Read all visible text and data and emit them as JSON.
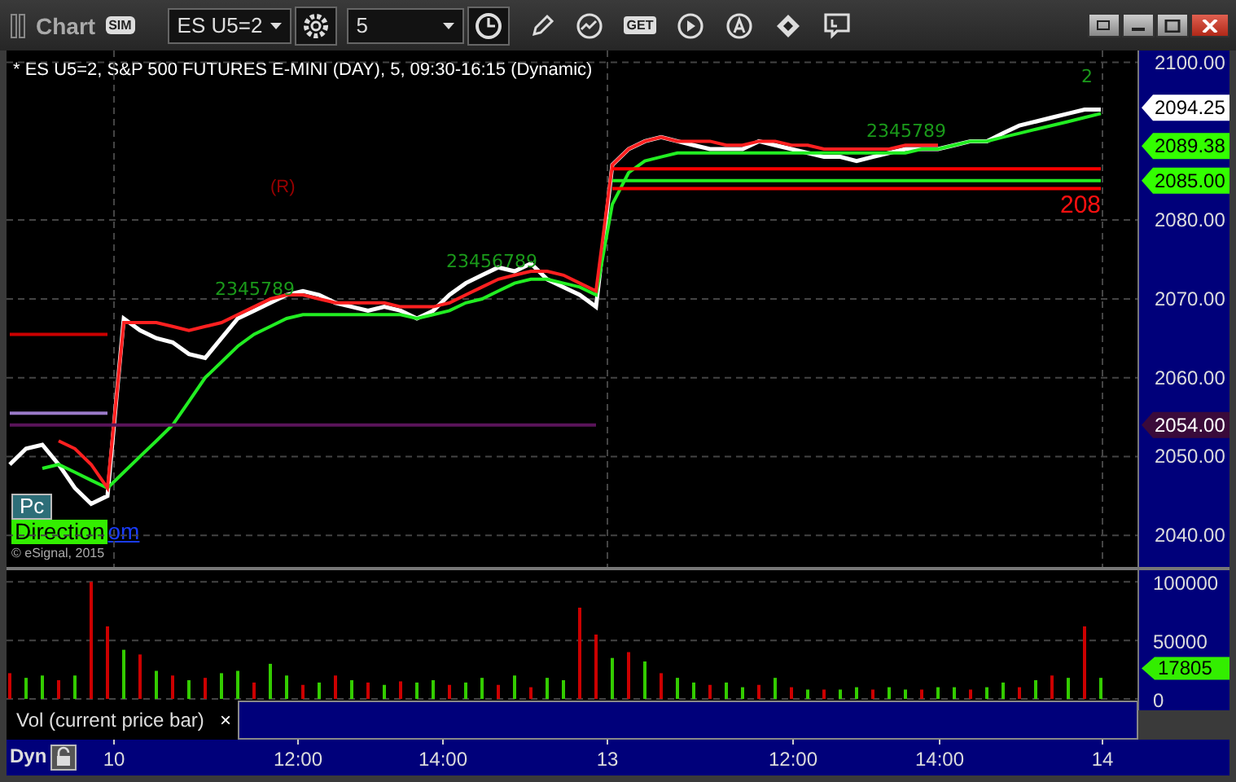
{
  "window": {
    "title": "Chart",
    "mode_badge": "SIM"
  },
  "toolbar": {
    "symbol": "ES U5=2",
    "interval": "5",
    "get_label": "GET"
  },
  "price_pane": {
    "header": "* ES U5=2, S&P 500 FUTURES E-MINI (DAY), 5, 09:30-16:15 (Dynamic)",
    "chart_data": {
      "type": "line",
      "grid": true,
      "ylim": [
        2036,
        2101.5
      ],
      "yticks": [
        {
          "value": 2040,
          "label": "2040.00"
        },
        {
          "value": 2050,
          "label": "2050.00"
        },
        {
          "value": 2060,
          "label": "2060.00"
        },
        {
          "value": 2070,
          "label": "2070.00"
        },
        {
          "value": 2080,
          "label": "2080.00"
        },
        {
          "value": 2100,
          "label": "2100.00"
        }
      ],
      "series": [
        {
          "color": "#ffffff",
          "values": [
            2049,
            2051,
            2051.5,
            2049,
            2046,
            2044,
            2045,
            2067.5,
            2066,
            2065,
            2064.5,
            2063,
            2062.5,
            2065,
            2067.5,
            2068.5,
            2069.5,
            2070.5,
            2071,
            2070.5,
            2069.5,
            2069,
            2068.5,
            2069,
            2068.5,
            2067.5,
            2068.5,
            2070.5,
            2072,
            2073,
            2074,
            2073.5,
            2074.5,
            2072.5,
            2071.5,
            2070.5,
            2069,
            2087,
            2089,
            2090,
            2090.5,
            2090,
            2089.5,
            2089,
            2089,
            2089,
            2090,
            2089.5,
            2089,
            2088.5,
            2088,
            2088,
            2087.5,
            2088,
            2088.5,
            2089,
            2089,
            2089,
            2089.5,
            2090,
            2090,
            2091,
            2092,
            2092.5,
            2093,
            2093.5,
            2094,
            2094
          ]
        },
        {
          "color": "#22ee22",
          "values": [
            null,
            null,
            2048.5,
            2049,
            2048,
            2047,
            2046,
            2048,
            2050,
            2052,
            2054,
            2057,
            2060,
            2062,
            2064,
            2065.5,
            2066.5,
            2067.5,
            2068,
            2068,
            2068,
            2068,
            2068,
            2068,
            2068,
            2067.5,
            2068,
            2068.5,
            2069.5,
            2070,
            2071,
            2072,
            2072.5,
            2072.5,
            2072,
            2071.5,
            2070.5,
            2082,
            2086,
            2087.5,
            2088,
            2088.5,
            2088.5,
            2088.5,
            2088.5,
            2088.5,
            2088.5,
            2088.5,
            2088.5,
            2088.5,
            2088.5,
            2088.5,
            2088.5,
            2088.5,
            2088.5,
            2088.5,
            2089,
            2089,
            2089.5,
            2090,
            2090,
            2090.5,
            2091,
            2091.5,
            2092,
            2092.5,
            2093,
            2093.5
          ]
        },
        {
          "color": "#ff2020",
          "values": [
            null,
            null,
            null,
            2052,
            2051,
            2049,
            2046,
            2067,
            2067,
            2067,
            2066.5,
            2066,
            2066.5,
            2067,
            2068,
            2069,
            2070,
            2070.5,
            2070.5,
            2070,
            2069.5,
            2069.5,
            2069.5,
            2069.5,
            2069,
            2069,
            2069,
            2069.5,
            2070.5,
            2071.5,
            2072.5,
            2073,
            2073.5,
            2073.5,
            2073,
            2072,
            2071,
            2087,
            2089,
            2090,
            2090.5,
            2090,
            2090,
            2090,
            2089.5,
            2089.5,
            2090,
            2090,
            2089.5,
            2089.5,
            2089,
            2089,
            2089,
            2089,
            2089,
            2089.5,
            2089.5,
            2089.5,
            null,
            null,
            null,
            null,
            null,
            null,
            null,
            null,
            null,
            null
          ]
        },
        {
          "color": "#cc0000",
          "values": [
            2065.5,
            2065.5,
            2065.5,
            2065.5,
            2065.5,
            2065.5,
            2065.5,
            null,
            null,
            null,
            null,
            null,
            null,
            null,
            null,
            null,
            null,
            null,
            null,
            null,
            null,
            null,
            null,
            null,
            null,
            null,
            null,
            null,
            null,
            null,
            null,
            null,
            null,
            null,
            null,
            null,
            null,
            null,
            null,
            null,
            null,
            null,
            null,
            null,
            null,
            null,
            null,
            null,
            null,
            null,
            null,
            null,
            null,
            null,
            null,
            null,
            null,
            null,
            null,
            null,
            null,
            null,
            null,
            null,
            null,
            null,
            null,
            null
          ]
        },
        {
          "color": "#9a7ac8",
          "values": [
            2055.5,
            2055.5,
            2055.5,
            2055.5,
            2055.5,
            2055.5,
            2055.5,
            null,
            null,
            null,
            null,
            null,
            null,
            null,
            null,
            null,
            null,
            null,
            null,
            null,
            null,
            null,
            null,
            null,
            null,
            null,
            null,
            null,
            null,
            null,
            null,
            null,
            null,
            null,
            null,
            null,
            null,
            null,
            null,
            null,
            null,
            null,
            null,
            null,
            null,
            null,
            null,
            null,
            null,
            null,
            null,
            null,
            null,
            null,
            null,
            null,
            null,
            null,
            null,
            null,
            null,
            null,
            null,
            null,
            null,
            null,
            null,
            null
          ]
        },
        {
          "color": "#ff0000",
          "values": [
            null,
            null,
            null,
            null,
            null,
            null,
            null,
            null,
            null,
            null,
            null,
            null,
            null,
            null,
            null,
            null,
            null,
            null,
            null,
            null,
            null,
            null,
            null,
            null,
            null,
            null,
            null,
            null,
            null,
            null,
            null,
            null,
            null,
            null,
            null,
            null,
            null,
            2086.5,
            2086.5,
            2086.5,
            2086.5,
            2086.5,
            2086.5,
            2086.5,
            2086.5,
            2086.5,
            2086.5,
            2086.5,
            2086.5,
            2086.5,
            2086.5,
            2086.5,
            2086.5,
            2086.5,
            2086.5,
            2086.5,
            2086.5,
            2086.5,
            2086.5,
            2086.5,
            2086.5,
            2086.5,
            2086.5,
            2086.5,
            2086.5,
            2086.5,
            2086.5,
            2086.5
          ]
        },
        {
          "color": "#ff0000",
          "values": [
            null,
            null,
            null,
            null,
            null,
            null,
            null,
            null,
            null,
            null,
            null,
            null,
            null,
            null,
            null,
            null,
            null,
            null,
            null,
            null,
            null,
            null,
            null,
            null,
            null,
            null,
            null,
            null,
            null,
            null,
            null,
            null,
            null,
            null,
            null,
            null,
            null,
            2084,
            2084,
            2084,
            2084,
            2084,
            2084,
            2084,
            2084,
            2084,
            2084,
            2084,
            2084,
            2084,
            2084,
            2084,
            2084,
            2084,
            2084,
            2084,
            2084,
            2084,
            2084,
            2084,
            2084,
            2084,
            2084,
            2084,
            2084,
            2084,
            2084,
            2084
          ]
        },
        {
          "color": "#22ee22",
          "values": [
            null,
            null,
            null,
            null,
            null,
            null,
            null,
            null,
            null,
            null,
            null,
            null,
            null,
            null,
            null,
            null,
            null,
            null,
            null,
            null,
            null,
            null,
            null,
            null,
            null,
            null,
            null,
            null,
            null,
            null,
            null,
            null,
            null,
            null,
            null,
            null,
            null,
            2085,
            2085,
            2085,
            2085,
            2085,
            2085,
            2085,
            2085,
            2085,
            2085,
            2085,
            2085,
            2085,
            2085,
            2085,
            2085,
            2085,
            2085,
            2085,
            2085,
            2085,
            2085,
            2085,
            2085,
            2085,
            2085,
            2085,
            2085,
            2085,
            2085,
            2085
          ]
        },
        {
          "color": "#5a145a",
          "values": [
            2054,
            2054,
            2054,
            2054,
            2054,
            2054,
            2054,
            2054,
            2054,
            2054,
            2054,
            2054,
            2054,
            2054,
            2054,
            2054,
            2054,
            2054,
            2054,
            2054,
            2054,
            2054,
            2054,
            2054,
            2054,
            2054,
            2054,
            2054,
            2054,
            2054,
            2054,
            2054,
            2054,
            2054,
            2054,
            2054,
            2054,
            null,
            null,
            null,
            null,
            null,
            null,
            null,
            null,
            null,
            null,
            null,
            null,
            null,
            null,
            null,
            null,
            null,
            null,
            null,
            null,
            null,
            null,
            null,
            null,
            null,
            null,
            null,
            null,
            null,
            null,
            null
          ]
        }
      ],
      "annotations": [
        "2345789",
        "23456789",
        "2345789",
        "2"
      ]
    },
    "rule_marker": "(R)",
    "price_tags": [
      {
        "text": "2094.25",
        "color": "#ffffff"
      },
      {
        "text": "2089.38",
        "color": "#33ff00"
      },
      {
        "text": "2085.00",
        "color": "#33ff00"
      },
      {
        "text": "2054.00",
        "color": "#3a0a3a"
      }
    ],
    "level_label": "208",
    "pc_label": "Pc",
    "direction_label": "Direction",
    "link_text": "om",
    "copyright": "© eSignal, 2015"
  },
  "volume_pane": {
    "chart_data": {
      "type": "bar",
      "ylim": [
        0,
        110000
      ],
      "yticks": [
        0,
        50000,
        100000
      ],
      "series": [
        {
          "name": "Vol (current price bar)",
          "color": "#33cc00",
          "values": [
            null,
            18000,
            20000,
            null,
            20000,
            null,
            null,
            42000,
            null,
            24000,
            null,
            16000,
            null,
            22000,
            24000,
            null,
            30000,
            20000,
            null,
            14000,
            null,
            16000,
            null,
            12000,
            null,
            14000,
            16000,
            null,
            14000,
            18000,
            null,
            20000,
            null,
            18000,
            16000,
            null,
            null,
            35000,
            null,
            32000,
            null,
            18000,
            14000,
            null,
            14000,
            10000,
            null,
            18000,
            null,
            8000,
            null,
            8000,
            10000,
            null,
            10000,
            8000,
            null,
            10000,
            10000,
            null,
            10000,
            14000,
            null,
            16000,
            null,
            18000,
            null,
            18000
          ]
        },
        {
          "color": "#cc0000",
          "values": [
            22000,
            null,
            null,
            16000,
            null,
            100000,
            62000,
            null,
            38000,
            null,
            20000,
            null,
            18000,
            null,
            null,
            14000,
            null,
            null,
            12000,
            null,
            20000,
            null,
            14000,
            null,
            15000,
            null,
            null,
            12000,
            null,
            null,
            12000,
            null,
            10000,
            null,
            null,
            78000,
            55000,
            null,
            40000,
            null,
            22000,
            null,
            null,
            12000,
            null,
            null,
            12000,
            null,
            10000,
            null,
            8000,
            null,
            null,
            8000,
            null,
            null,
            8000,
            null,
            null,
            8000,
            null,
            null,
            10000,
            null,
            20000,
            null,
            62000,
            null
          ]
        }
      ]
    },
    "value_tag": "17805",
    "legend_close": "×"
  },
  "time_axis": {
    "mode": "Dyn",
    "labels": [
      "10",
      "12:00",
      "14:00",
      "13",
      "12:00",
      "14:00",
      "14"
    ]
  }
}
